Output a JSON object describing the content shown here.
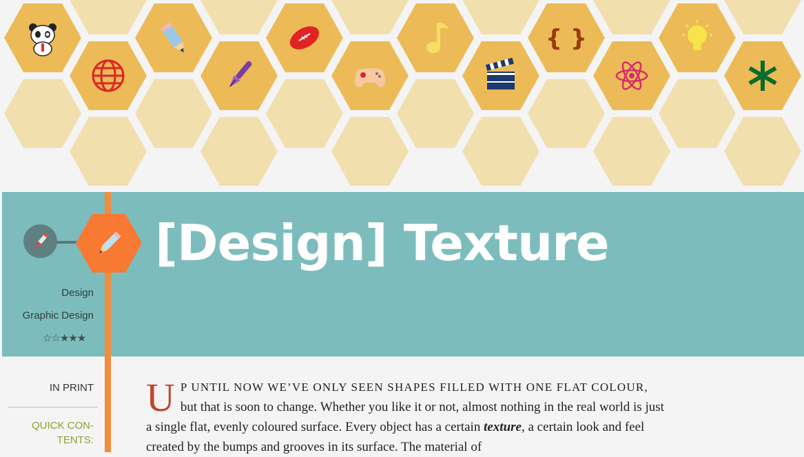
{
  "banner": {
    "icons": [
      "panda-icon",
      "globe-icon",
      "pencil-icon",
      "fountain-pen-icon",
      "football-icon",
      "gamepad-icon",
      "music-note-icon",
      "clapperboard-icon",
      "curly-braces-icon",
      "atom-icon",
      "lightbulb-icon",
      "asterisk-icon"
    ]
  },
  "category": {
    "icon": "pen-nib-icon",
    "badge_icon": "pencil-icon"
  },
  "post": {
    "title": "[Design] Texture",
    "tags": [
      "Design",
      "Graphic Design"
    ],
    "rating": {
      "value": 3,
      "max": 5,
      "empty_stars": "☆☆",
      "full_stars": "★★★"
    }
  },
  "sidebar": {
    "in_print": "IN PRINT",
    "quick_contents": "QUICK CON-TENTS:"
  },
  "article": {
    "dropcap": "U",
    "lead": "p until now we’ve only seen shapes filled with one flat colour,",
    "text_1": " but that is soon to change. Whether you like it or not, almost nothing in the real world is just a single flat, evenly coloured surface. Every object has a certain ",
    "emphasis": "texture",
    "text_2": ", a certain look and feel created by the bumps and grooves in its surface. The material of"
  },
  "colors": {
    "hex_light": "#f2dfae",
    "hex_dark": "#ecbb58",
    "title_band": "#7dbcbc",
    "timeline": "#f18d3b",
    "badge": "#f87932",
    "dropcap": "#c0472a",
    "quick_contents": "#8ca234"
  }
}
